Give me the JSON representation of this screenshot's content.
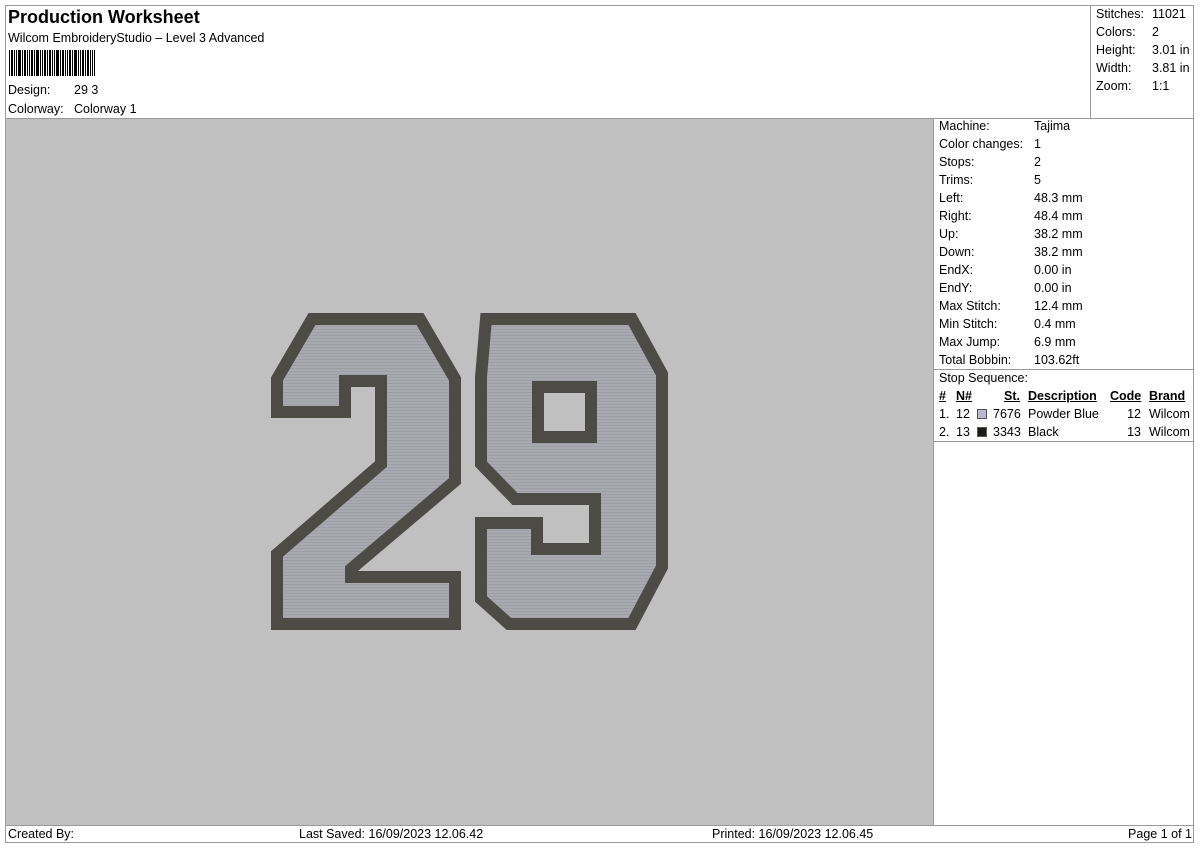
{
  "header": {
    "title": "Production Worksheet",
    "software": "Wilcom EmbroideryStudio – Level 3 Advanced",
    "design_label": "Design:",
    "design_value": "29 3",
    "colorway_label": "Colorway:",
    "colorway_value": "Colorway 1"
  },
  "summary": {
    "stitches_label": "Stitches:",
    "stitches": "11021",
    "colors_label": "Colors:",
    "colors": "2",
    "height_label": "Height:",
    "height": "3.01 in",
    "width_label": "Width:",
    "width": "3.81 in",
    "zoom_label": "Zoom:",
    "zoom": "1:1"
  },
  "details": [
    {
      "label": "Machine:",
      "value": "Tajima"
    },
    {
      "label": "Color changes:",
      "value": "1"
    },
    {
      "label": "Stops:",
      "value": "2"
    },
    {
      "label": "Trims:",
      "value": "5"
    },
    {
      "label": "Left:",
      "value": "48.3 mm"
    },
    {
      "label": "Right:",
      "value": "48.4 mm"
    },
    {
      "label": "Up:",
      "value": "38.2 mm"
    },
    {
      "label": "Down:",
      "value": "38.2 mm"
    },
    {
      "label": "EndX:",
      "value": "0.00 in"
    },
    {
      "label": "EndY:",
      "value": "0.00 in"
    },
    {
      "label": "Max Stitch:",
      "value": "12.4 mm"
    },
    {
      "label": "Min Stitch:",
      "value": "0.4 mm"
    },
    {
      "label": "Max Jump:",
      "value": "6.9 mm"
    },
    {
      "label": "Total Bobbin:",
      "value": "103.62ft"
    }
  ],
  "stop_sequence": {
    "label": "Stop Sequence:",
    "headers": {
      "num": "#",
      "n": "N#",
      "st": "St.",
      "description": "Description",
      "code": "Code",
      "brand": "Brand"
    },
    "rows": [
      {
        "num": "1.",
        "n": "12",
        "swatch": "#b9b9d6",
        "st": "7676",
        "description": "Powder Blue",
        "code": "12",
        "brand": "Wilcom"
      },
      {
        "num": "2.",
        "n": "13",
        "swatch": "#1d1a16",
        "st": "3343",
        "description": "Black",
        "code": "13",
        "brand": "Wilcom"
      }
    ]
  },
  "design_preview": {
    "text": "29",
    "fill_color": "#a7a7ae",
    "outline_color": "#4d4b45",
    "background": "#c0c0c0"
  },
  "footer": {
    "created_by": "Created By:",
    "last_saved": "Last Saved: 16/09/2023 12.06.42",
    "printed": "Printed: 16/09/2023 12.06.45",
    "page": "Page 1 of 1"
  }
}
